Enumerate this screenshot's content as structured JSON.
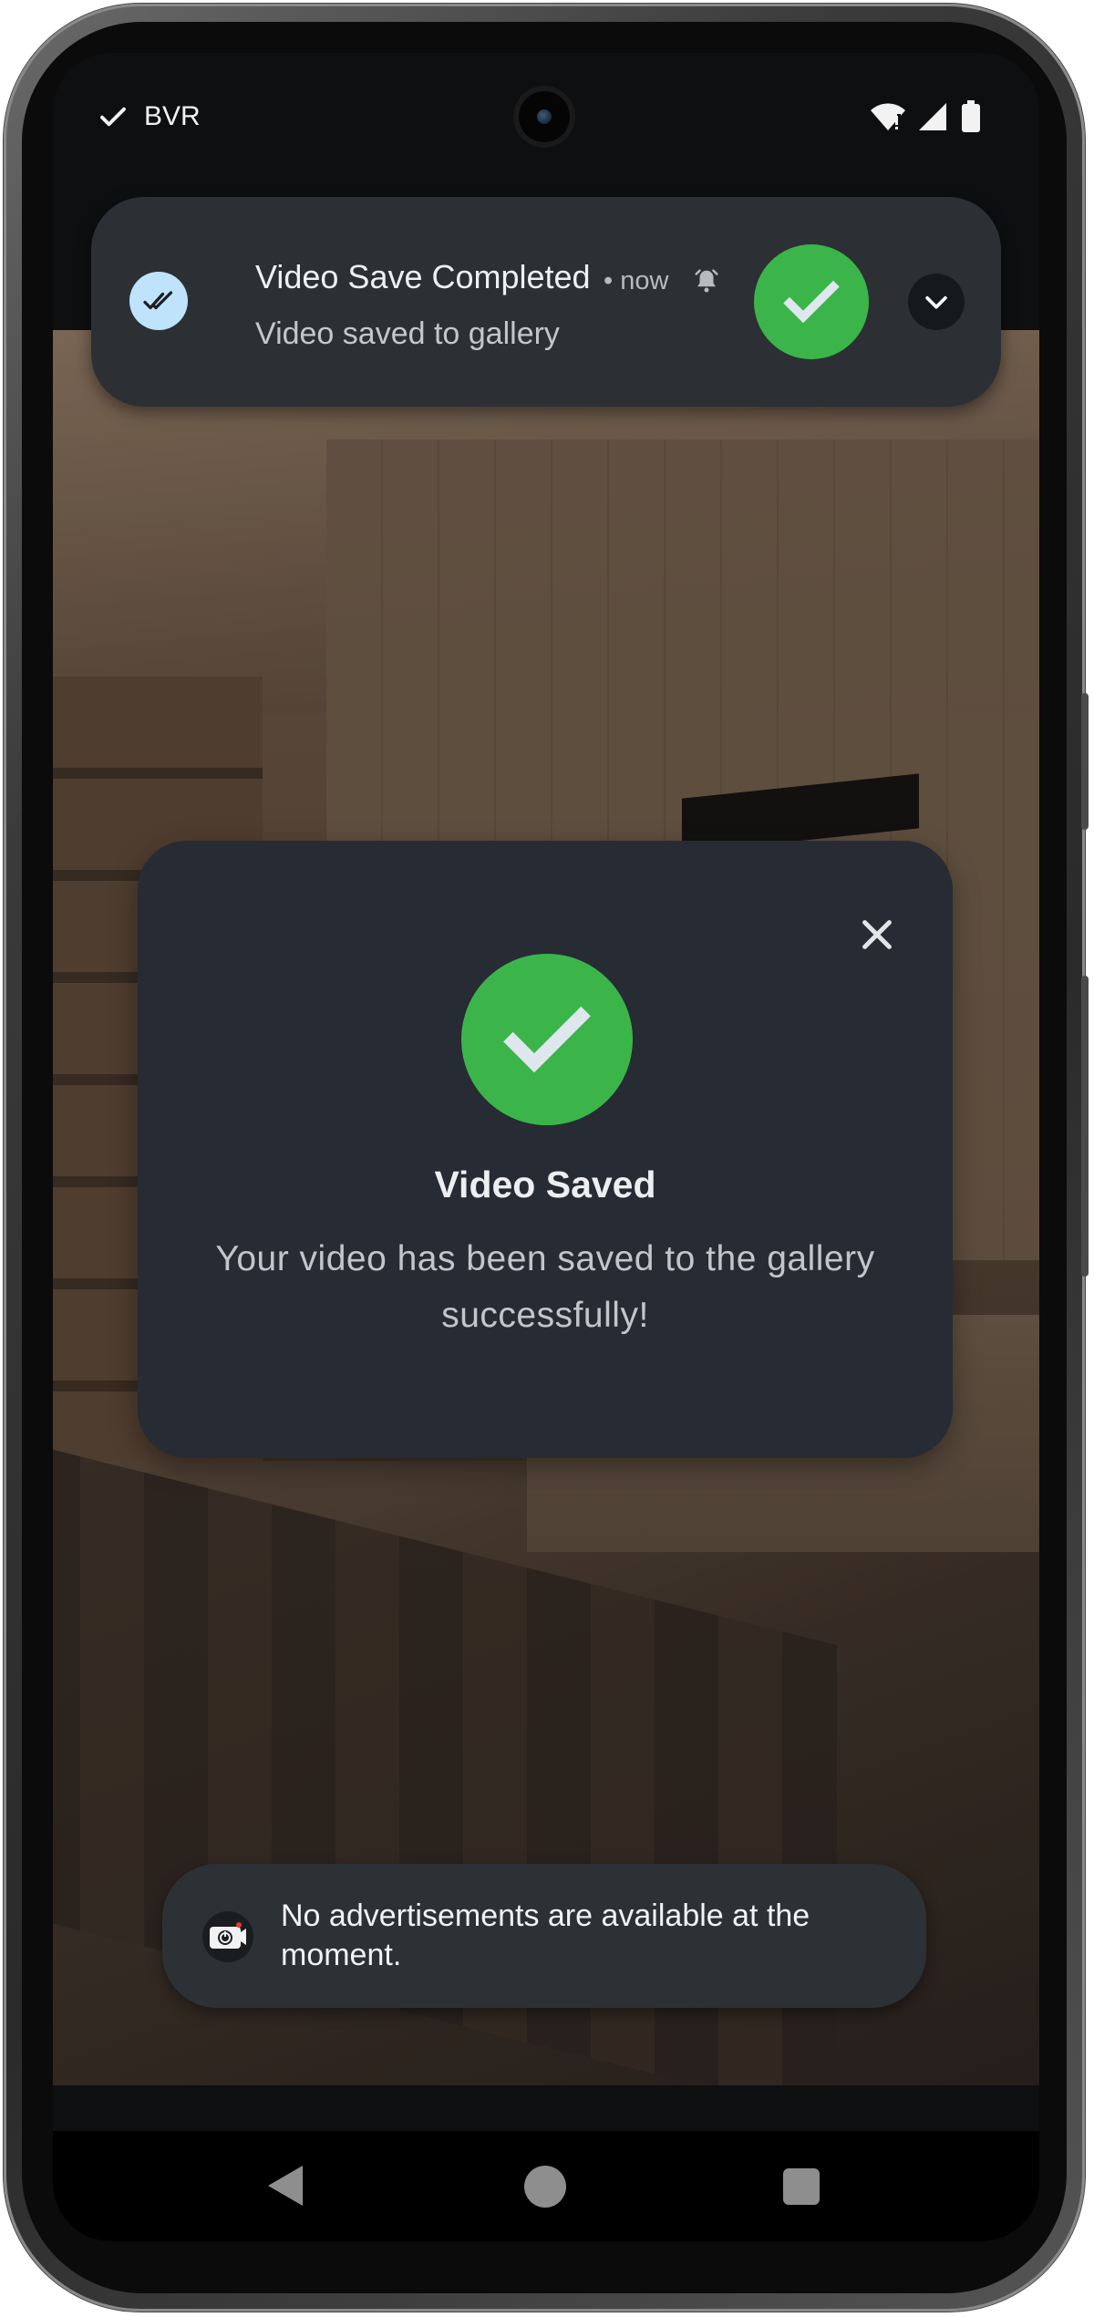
{
  "status_bar": {
    "carrier": "BVR",
    "icons": [
      "check-icon",
      "wifi-icon",
      "signal-icon",
      "battery-icon"
    ]
  },
  "notification": {
    "app_icon": "double-check-icon",
    "title": "Video Save Completed",
    "time": "• now",
    "text": "Video saved to gallery",
    "accent": "#3bb54a"
  },
  "dialog": {
    "title": "Video Saved",
    "message": "Your video has been saved to the gallery successfully!",
    "accent": "#3bb54a"
  },
  "toast": {
    "text": "No advertisements are available at the moment."
  },
  "nav": {
    "buttons": [
      "back",
      "home",
      "recents"
    ]
  }
}
